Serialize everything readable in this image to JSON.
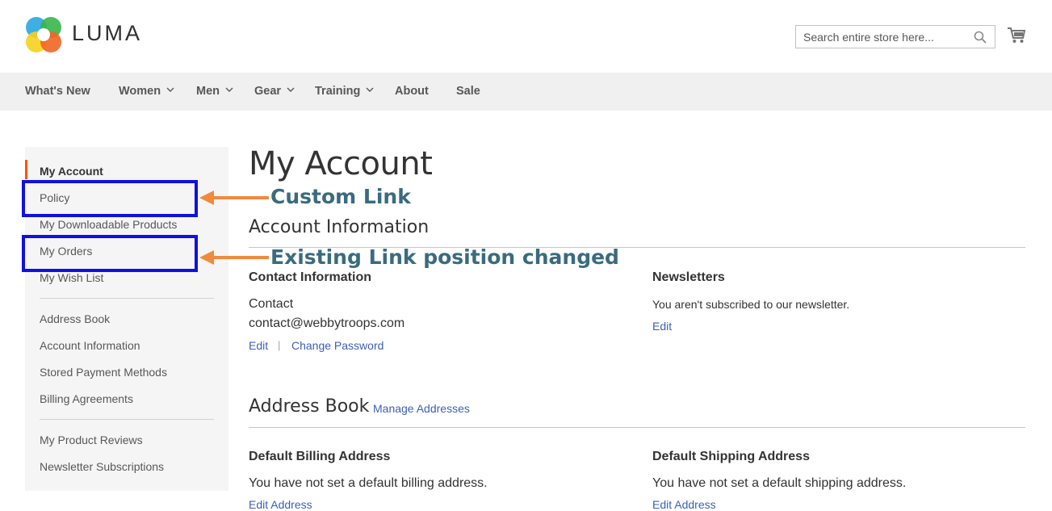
{
  "brand": {
    "logo_text": "LUMA"
  },
  "search": {
    "placeholder": "Search entire store here..."
  },
  "nav": {
    "items": [
      {
        "label": "What's New",
        "has_dropdown": false
      },
      {
        "label": "Women",
        "has_dropdown": true
      },
      {
        "label": "Men",
        "has_dropdown": true
      },
      {
        "label": "Gear",
        "has_dropdown": true
      },
      {
        "label": "Training",
        "has_dropdown": true
      },
      {
        "label": "About",
        "has_dropdown": false
      },
      {
        "label": "Sale",
        "has_dropdown": false
      }
    ]
  },
  "sidebar": {
    "groups": [
      [
        "My Account",
        "Policy",
        "My Downloadable Products",
        "My Orders",
        "My Wish List"
      ],
      [
        "Address Book",
        "Account Information",
        "Stored Payment Methods",
        "Billing Agreements"
      ],
      [
        "My Product Reviews",
        "Newsletter Subscriptions"
      ]
    ],
    "current": "My Account"
  },
  "annotations": {
    "custom_link": "Custom Link",
    "position_changed": "Existing Link position changed"
  },
  "main": {
    "title": "My Account",
    "account_info": {
      "title": "Account Information",
      "contact": {
        "title": "Contact Information",
        "name": "Contact",
        "email": "contact@webbytroops.com",
        "edit": "Edit",
        "change_password": "Change Password",
        "separator": "|"
      },
      "newsletters": {
        "title": "Newsletters",
        "text": "You aren't subscribed to our newsletter.",
        "edit": "Edit"
      }
    },
    "address_book": {
      "title": "Address Book",
      "manage": "Manage Addresses",
      "billing": {
        "title": "Default Billing Address",
        "text": "You have not set a default billing address.",
        "edit": "Edit Address"
      },
      "shipping": {
        "title": "Default Shipping Address",
        "text": "You have not set a default shipping address.",
        "edit": "Edit Address"
      }
    }
  },
  "colors": {
    "accent": "#ff5501",
    "link": "#3c5fb6",
    "annotation_text": "#3a6b7e",
    "annotation_arrow": "#f08a3c",
    "highlight_box": "#1010e0"
  }
}
